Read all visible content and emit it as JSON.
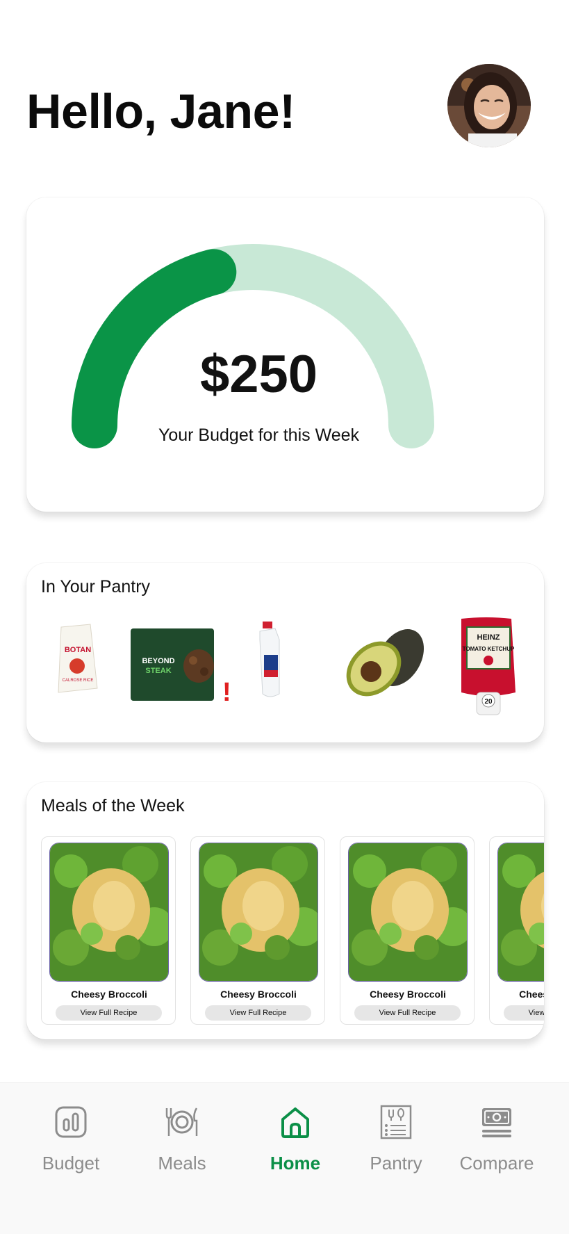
{
  "header": {
    "greeting": "Hello, Jane!"
  },
  "budget": {
    "amount": "$250",
    "label": "Your Budget for this Week",
    "spent_fraction": 0.42,
    "accent": "#0a9447",
    "track": "#c8e8d6"
  },
  "pantry": {
    "title": "In Your Pantry",
    "items": [
      {
        "name": "Botan Calrose Rice",
        "icon": "rice-bag-icon"
      },
      {
        "name": "Beyond Steak",
        "icon": "meat-package-icon",
        "alert": "!"
      },
      {
        "name": "Milk",
        "icon": "milk-jug-icon"
      },
      {
        "name": "Avocado",
        "icon": "avocado-icon"
      },
      {
        "name": "Heinz Tomato Ketchup",
        "icon": "ketchup-bottle-icon"
      }
    ],
    "rice_label": "BOTAN",
    "rice_sub": "CALROSE RICE",
    "steak_label": "BEYOND",
    "steak_sub": "STEAK",
    "ketchup_brand": "HEINZ",
    "ketchup_label": "TOMATO KETCHUP",
    "ketchup_size": "20"
  },
  "meals": {
    "title": "Meals of the Week",
    "items": [
      {
        "name": "Cheesy Broccoli",
        "button": "View Full Recipe"
      },
      {
        "name": "Cheesy Broccoli",
        "button": "View Full Recipe"
      },
      {
        "name": "Cheesy Broccoli",
        "button": "View Full Recipe"
      },
      {
        "name": "Cheesy Broccoli",
        "button": "View Full Recipe"
      }
    ]
  },
  "nav": {
    "active_color": "#0b8f47",
    "items": [
      {
        "label": "Budget",
        "icon": "budget-chart-icon"
      },
      {
        "label": "Meals",
        "icon": "plate-utensils-icon"
      },
      {
        "label": "Home",
        "icon": "home-icon",
        "active": true
      },
      {
        "label": "Pantry",
        "icon": "pantry-list-icon"
      },
      {
        "label": "Compare",
        "icon": "compare-money-icon"
      }
    ]
  }
}
